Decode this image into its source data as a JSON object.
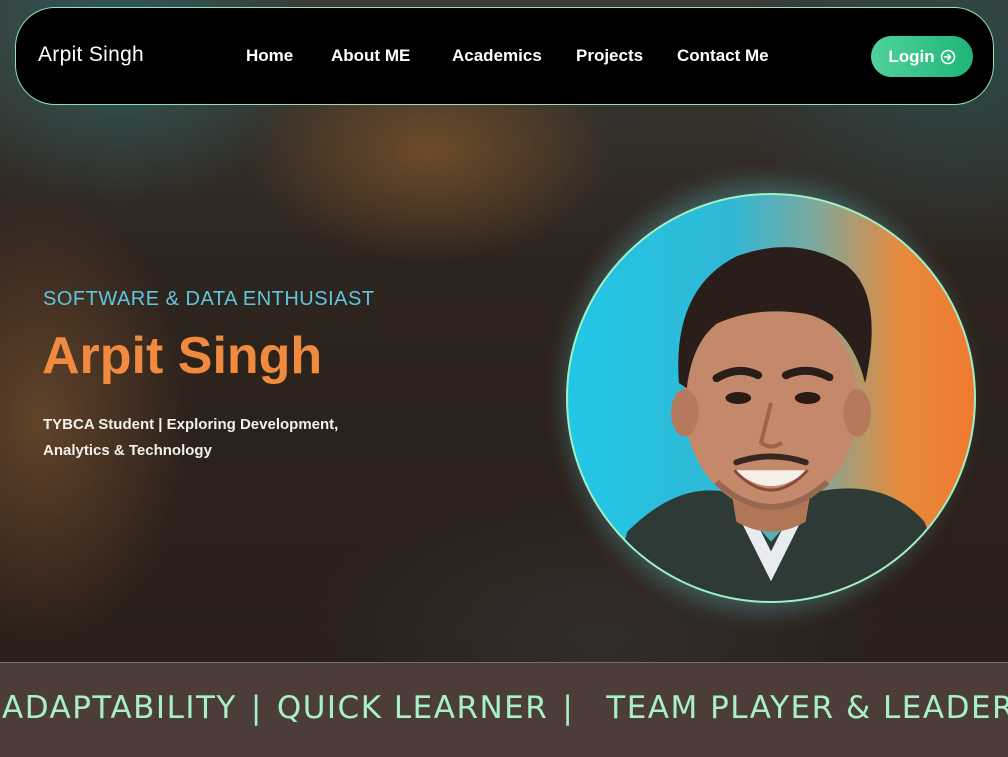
{
  "navbar": {
    "brand": "Arpit Singh",
    "links": [
      "Home",
      "About ME",
      "Academics",
      "Projects",
      "Contact Me"
    ],
    "login_label": "Login"
  },
  "hero": {
    "eyebrow": "SOFTWARE & DATA ENTHUSIAST",
    "name": "Arpit Singh",
    "description": "TYBCA Student | Exploring Development, Analytics & Technology"
  },
  "marquee": {
    "items": [
      "ADAPTABILITY",
      "QUICK LEARNER",
      "TEAM PLAYER & LEADER"
    ],
    "separator": "|"
  },
  "colors": {
    "accent_orange": "#f08a3e",
    "accent_cyan": "#5ec7e0",
    "accent_mint": "#a8f0c6",
    "nav_bg": "#000000"
  }
}
